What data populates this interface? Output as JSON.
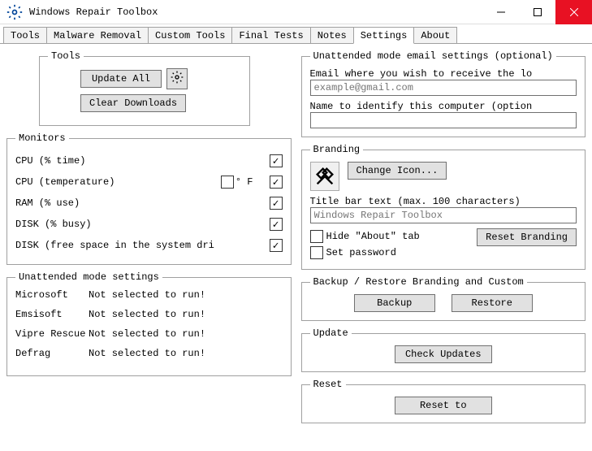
{
  "window": {
    "title": "Windows Repair Toolbox"
  },
  "tabs": {
    "t0": "Tools",
    "t1": "Malware Removal",
    "t2": "Custom Tools",
    "t3": "Final Tests",
    "t4": "Notes",
    "t5": "Settings",
    "t6": "About"
  },
  "tools": {
    "legend": "Tools",
    "update_all": "Update All",
    "clear_downloads": "Clear Downloads"
  },
  "monitors": {
    "legend": "Monitors",
    "cpu_time": "CPU (% time)",
    "cpu_temp": "CPU (temperature)",
    "fahrenheit_label": "° F",
    "ram": "RAM (% use)",
    "disk_busy": "DISK (% busy)",
    "disk_free": "DISK (free space in the system dri",
    "cpu_time_checked": true,
    "cpu_temp_checked": true,
    "fahrenheit_checked": false,
    "ram_checked": true,
    "disk_busy_checked": true,
    "disk_free_checked": true
  },
  "unattended": {
    "legend": "Unattended mode settings",
    "not_selected": "Not selected to run!",
    "apps": {
      "microsoft": "Microsoft",
      "emsisoft": "Emsisoft",
      "vipre": "Vipre Rescue",
      "defrag": "Defrag"
    }
  },
  "email": {
    "legend": "Unattended mode email settings (optional)",
    "email_label": "Email where you wish to receive the lo",
    "email_placeholder": "example@gmail.com",
    "name_label": "Name to identify this computer (option"
  },
  "branding": {
    "legend": "Branding",
    "change_icon": "Change Icon...",
    "titlebar_label": "Title bar text (max. 100 characters)",
    "titlebar_placeholder": "Windows Repair Toolbox",
    "hide_about": "Hide \"About\" tab",
    "set_password": "Set password",
    "reset_branding": "Reset Branding"
  },
  "backup": {
    "legend": "Backup / Restore Branding and Custom",
    "backup": "Backup",
    "restore": "Restore"
  },
  "update": {
    "legend": "Update",
    "check": "Check Updates"
  },
  "reset": {
    "legend": "Reset",
    "reset_to": "Reset to"
  }
}
